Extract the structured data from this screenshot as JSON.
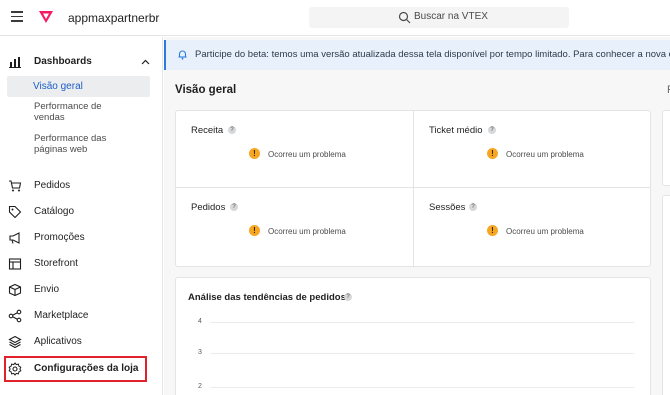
{
  "app": {
    "name": "appmaxpartnerbr"
  },
  "search": {
    "placeholder": "Buscar na VTEX"
  },
  "sidebar": {
    "dashboards": {
      "label": "Dashboards"
    },
    "sub_items": [
      {
        "label": "Visão geral"
      },
      {
        "label": "Performance de vendas"
      },
      {
        "label": "Performance das páginas web"
      }
    ],
    "items": [
      {
        "label": "Pedidos"
      },
      {
        "label": "Catálogo"
      },
      {
        "label": "Promoções"
      },
      {
        "label": "Storefront"
      },
      {
        "label": "Envio"
      },
      {
        "label": "Marketplace"
      },
      {
        "label": "Aplicativos"
      },
      {
        "label": "Configurações da loja"
      }
    ]
  },
  "banner": {
    "text": "Participe do beta: temos uma versão atualizada dessa tela disponível por tempo limitado. Para conhecer a nova ex"
  },
  "page": {
    "title": "Visão geral",
    "side_text": "P"
  },
  "metrics": [
    {
      "title": "Receita",
      "error": "Ocorreu um problema"
    },
    {
      "title": "Ticket médio",
      "error": "Ocorreu um problema"
    },
    {
      "title": "Pedidos",
      "error": "Ocorreu um problema"
    },
    {
      "title": "Sessões",
      "error": "Ocorreu um problema"
    }
  ],
  "trend": {
    "title": "Análise das tendências de pedidos",
    "ticks": [
      "4",
      "3",
      "2"
    ]
  },
  "help_glyph": "?",
  "warn_glyph": "!",
  "colors": {
    "accent": "#1d5fc9",
    "brand": "#f71963",
    "warning": "#f5a623",
    "highlight": "#e0232a"
  }
}
